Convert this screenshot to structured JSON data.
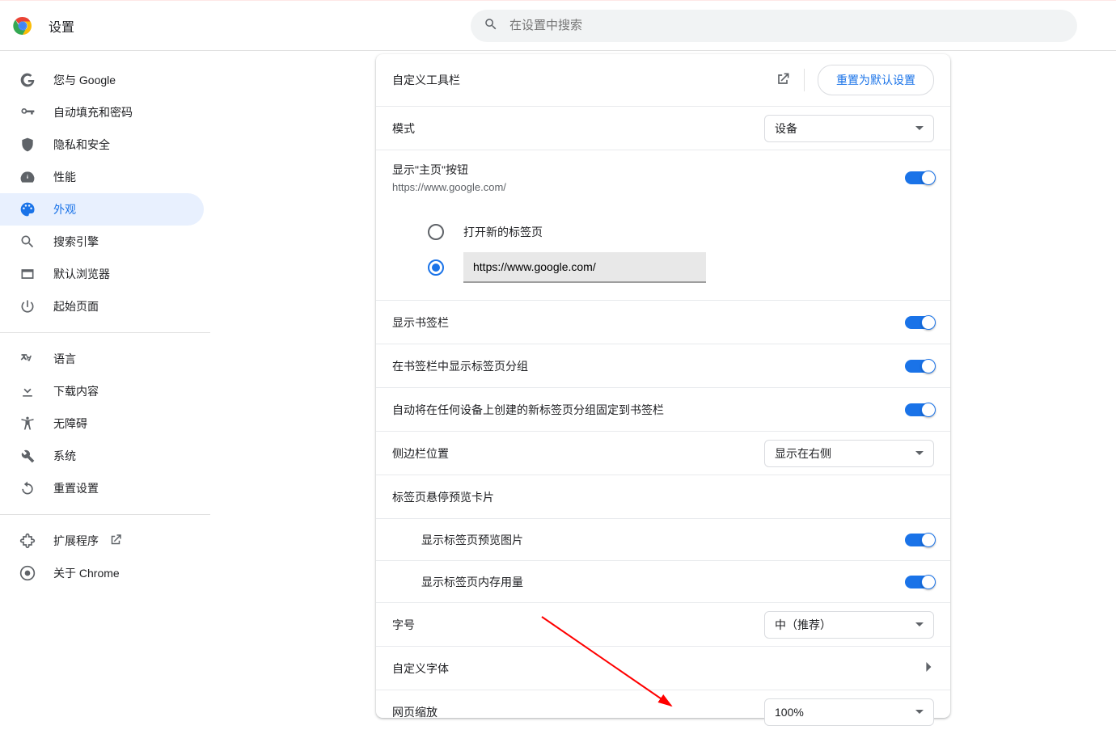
{
  "header": {
    "title": "设置",
    "search_placeholder": "在设置中搜索"
  },
  "sidebar": {
    "groups": [
      {
        "items": [
          {
            "id": "you-and-google",
            "label": "您与 Google"
          },
          {
            "id": "autofill",
            "label": "自动填充和密码"
          },
          {
            "id": "privacy",
            "label": "隐私和安全"
          },
          {
            "id": "performance",
            "label": "性能"
          },
          {
            "id": "appearance",
            "label": "外观",
            "active": true
          },
          {
            "id": "search-engine",
            "label": "搜索引擎"
          },
          {
            "id": "default-browser",
            "label": "默认浏览器"
          },
          {
            "id": "on-startup",
            "label": "起始页面"
          }
        ]
      },
      {
        "items": [
          {
            "id": "languages",
            "label": "语言"
          },
          {
            "id": "downloads",
            "label": "下载内容"
          },
          {
            "id": "accessibility",
            "label": "无障碍"
          },
          {
            "id": "system",
            "label": "系统"
          },
          {
            "id": "reset",
            "label": "重置设置"
          }
        ]
      },
      {
        "items": [
          {
            "id": "extensions",
            "label": "扩展程序",
            "external": true
          },
          {
            "id": "about",
            "label": "关于 Chrome"
          }
        ]
      }
    ]
  },
  "main": {
    "customize_toolbar": {
      "label": "自定义工具栏",
      "reset_button": "重置为默认设置"
    },
    "mode": {
      "label": "模式",
      "value": "设备"
    },
    "home_button": {
      "label": "显示\"主页\"按钮",
      "sub": "https://www.google.com/",
      "on": true
    },
    "home_radio": {
      "option_newtab": "打开新的标签页",
      "option_custom_value": "https://www.google.com/",
      "selected": "custom"
    },
    "show_bookmarks_bar": {
      "label": "显示书签栏",
      "on": true
    },
    "show_tab_groups": {
      "label": "在书签栏中显示标签页分组",
      "on": true
    },
    "pin_tab_groups": {
      "label": "自动将在任何设备上创建的新标签页分组固定到书签栏",
      "on": true
    },
    "side_panel": {
      "label": "侧边栏位置",
      "value": "显示在右侧"
    },
    "hover_card": {
      "label": "标签页悬停预览卡片"
    },
    "show_preview_image": {
      "label": "显示标签页预览图片",
      "on": true
    },
    "show_memory_usage": {
      "label": "显示标签页内存用量",
      "on": true
    },
    "font_size": {
      "label": "字号",
      "value": "中（推荐）"
    },
    "custom_fonts": {
      "label": "自定义字体"
    },
    "page_zoom": {
      "label": "网页缩放",
      "value": "100%"
    }
  }
}
